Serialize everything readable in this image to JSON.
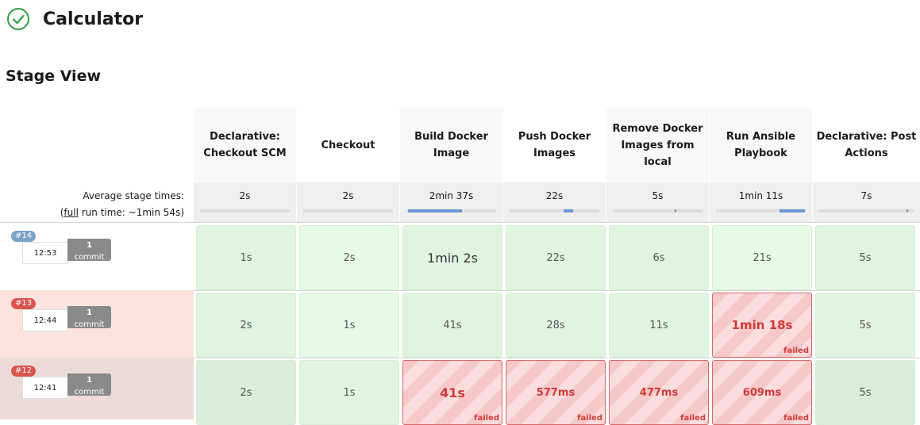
{
  "job": {
    "name": "Calculator",
    "status_icon": "check-circle-icon",
    "status_color": "#2f9e44"
  },
  "section_title": "Stage View",
  "stages": [
    "Declarative: Checkout SCM",
    "Checkout",
    "Build Docker Image",
    "Push Docker Images",
    "Remove Docker Images from local",
    "Run Ansible Playbook",
    "Declarative: Post Actions"
  ],
  "average": {
    "label": "Average stage times:",
    "full_prefix": "(",
    "full_word": "full",
    "full_suffix": " run time: ~1min 54s)",
    "times": [
      "2s",
      "2s",
      "2min 37s",
      "22s",
      "5s",
      "1min 11s",
      "7s"
    ]
  },
  "builds": [
    {
      "number": "#14",
      "badge_color": "#7ea3c9",
      "time": "12:53",
      "commit_count": "1",
      "commit_word": "commit",
      "row_color": "#ffffff",
      "stages": [
        {
          "duration": "1s",
          "failed": false
        },
        {
          "duration": "2s",
          "failed": false
        },
        {
          "duration": "1min 2s",
          "failed": false
        },
        {
          "duration": "22s",
          "failed": false
        },
        {
          "duration": "6s",
          "failed": false
        },
        {
          "duration": "21s",
          "failed": false
        },
        {
          "duration": "5s",
          "failed": false
        }
      ]
    },
    {
      "number": "#13",
      "badge_color": "#d9534f",
      "time": "12:44",
      "commit_count": "1",
      "commit_word": "commit",
      "row_color": "#fde3de",
      "stages": [
        {
          "duration": "2s",
          "failed": false
        },
        {
          "duration": "1s",
          "failed": false
        },
        {
          "duration": "41s",
          "failed": false
        },
        {
          "duration": "28s",
          "failed": false
        },
        {
          "duration": "11s",
          "failed": false
        },
        {
          "duration": "1min 18s",
          "failed": true
        },
        {
          "duration": "5s",
          "failed": false
        }
      ]
    },
    {
      "number": "#12",
      "badge_color": "#d9534f",
      "time": "12:41",
      "commit_count": "1",
      "commit_word": "commit",
      "row_color": "#ecdcd8",
      "stages": [
        {
          "duration": "2s",
          "failed": false
        },
        {
          "duration": "1s",
          "failed": false
        },
        {
          "duration": "41s",
          "failed": true
        },
        {
          "duration": "577ms",
          "failed": true
        },
        {
          "duration": "477ms",
          "failed": true
        },
        {
          "duration": "609ms",
          "failed": true
        },
        {
          "duration": "5s",
          "failed": false
        }
      ]
    }
  ],
  "failed_label": "failed"
}
